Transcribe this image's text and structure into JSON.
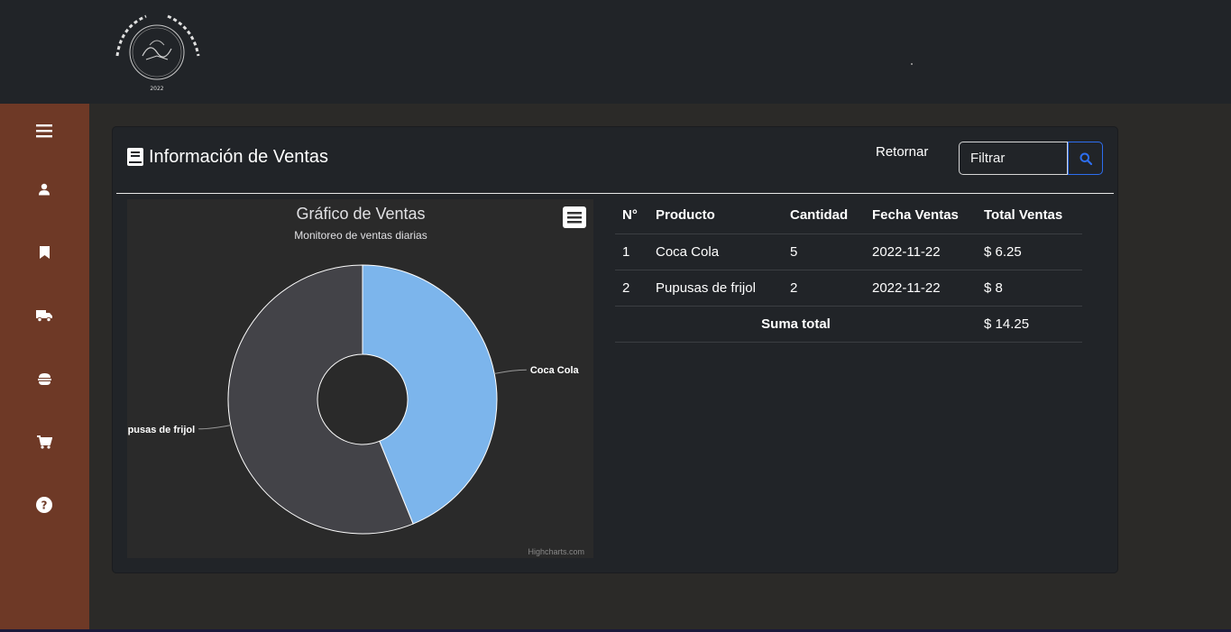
{
  "logo": {
    "text": "NOCHES DE EL SALVADOR",
    "year": "2022"
  },
  "sidebar": {
    "items": [
      {
        "icon": "hamburger-icon"
      },
      {
        "icon": "user-icon"
      },
      {
        "icon": "bookmark-icon"
      },
      {
        "icon": "truck-icon"
      },
      {
        "icon": "burger-icon"
      },
      {
        "icon": "cart-icon"
      },
      {
        "icon": "help-icon"
      }
    ]
  },
  "card": {
    "title": "Información de Ventas",
    "retornar": "Retornar",
    "filter_placeholder": "Filtrar"
  },
  "chart_data": {
    "type": "pie",
    "title": "Gráfico de Ventas",
    "subtitle": "Monitoreo de ventas diarias",
    "credits": "Highcharts.com",
    "series": [
      {
        "name": "Coca Cola",
        "value": 6.25,
        "color": "#7cb5ec"
      },
      {
        "name": "Pupusas de frijol",
        "value": 8,
        "color": "#434348"
      }
    ]
  },
  "table": {
    "headers": [
      "N°",
      "Producto",
      "Cantidad",
      "Fecha Ventas",
      "Total Ventas"
    ],
    "rows": [
      [
        "1",
        "Coca Cola",
        "5",
        "2022-11-22",
        "$ 6.25"
      ],
      [
        "2",
        "Pupusas de frijol",
        "2",
        "2022-11-22",
        "$ 8"
      ]
    ],
    "sum_label": "Suma total",
    "sum_value": "$ 14.25"
  }
}
